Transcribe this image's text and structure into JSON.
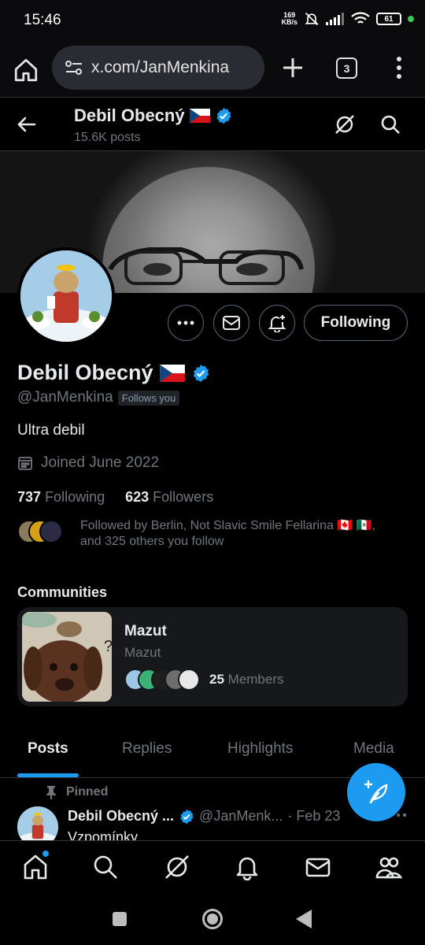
{
  "status_bar": {
    "time": "15:46",
    "net_speed_value": "169",
    "net_speed_unit": "KB/s",
    "battery": "61"
  },
  "browser": {
    "url": "x.com/JanMenkina",
    "tab_count": "3"
  },
  "header": {
    "name": "Debil Obecný",
    "posts_count": "15.6K posts"
  },
  "profile": {
    "name": "Debil Obecný",
    "handle": "@JanMenkina",
    "follows_you_badge": "Follows you",
    "bio": "Ultra debil",
    "joined": "Joined June 2022",
    "following_count": "737",
    "following_label": "Following",
    "followers_count": "623",
    "followers_label": "Followers",
    "followed_by_line1": "Followed by Berlin, Not Slavic Smile Fellarina 🇨🇦 🇲🇽,",
    "followed_by_line2": "and 325 others you follow",
    "follow_button_label": "Following"
  },
  "communities": {
    "title": "Communities",
    "items": [
      {
        "name": "Mazut",
        "subtitle": "Mazut",
        "member_count": "25",
        "member_label": "Members"
      }
    ]
  },
  "tabs": [
    {
      "label": "Posts",
      "active": true
    },
    {
      "label": "Replies",
      "active": false
    },
    {
      "label": "Highlights",
      "active": false
    },
    {
      "label": "Media",
      "active": false
    }
  ],
  "pinned_post": {
    "pinned_label": "Pinned",
    "author_name": "Debil Obecný ...",
    "author_handle": "@JanMenk...",
    "date": "· Feb 23",
    "text": "Vzpomínky"
  },
  "colors": {
    "accent": "#1d9bf0",
    "background": "#000000",
    "text_primary": "#e7e9ea",
    "text_secondary": "#71767b",
    "border": "#2f3336"
  },
  "icons": {
    "browser": [
      "home-icon",
      "site-settings-icon",
      "plus-icon",
      "tabs-icon",
      "more-vert-icon"
    ],
    "header": [
      "back-arrow-icon",
      "grok-icon",
      "search-icon"
    ],
    "actions": [
      "more-horizontal-icon",
      "message-icon",
      "notification-plus-icon"
    ],
    "nav": [
      "home-icon",
      "search-icon",
      "grok-icon",
      "bell-icon",
      "mail-icon",
      "communities-icon"
    ]
  }
}
